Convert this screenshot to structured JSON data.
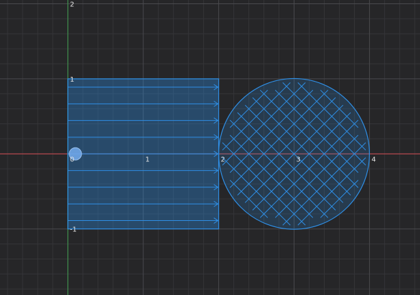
{
  "viewport": {
    "x_range": [
      -0.9,
      4.67
    ],
    "y_range": [
      -1.88,
      2.05
    ],
    "major_step": 1,
    "minor_divisions": 5
  },
  "axis_labels": {
    "x": [
      {
        "value": 0,
        "text": "0"
      },
      {
        "value": 1,
        "text": "1"
      },
      {
        "value": 2,
        "text": "2"
      },
      {
        "value": 3,
        "text": "3"
      },
      {
        "value": 4,
        "text": "4"
      }
    ],
    "y": [
      {
        "value": 2,
        "text": "2"
      },
      {
        "value": 1,
        "text": "1"
      },
      {
        "value": -1,
        "text": "-1"
      }
    ]
  },
  "colors": {
    "background": "#262628",
    "grid_minor": "#353538",
    "grid_major": "#4a4a4e",
    "x_axis": "#c0474d",
    "y_axis": "#3f8f4e",
    "shape_stroke": "#2f8fe6",
    "shape_fill": "#2f8fe6",
    "point": "#6fa6e8"
  },
  "shapes": {
    "rectangle": {
      "x_min": 0,
      "x_max": 2,
      "y_min": -1,
      "y_max": 1,
      "pattern": "arrows-right",
      "rows": 9
    },
    "circle": {
      "center": [
        3,
        0
      ],
      "radius": 1,
      "pattern": "crosses",
      "spacing": 0.2
    },
    "point": {
      "x": 0.1,
      "y": 0
    }
  }
}
